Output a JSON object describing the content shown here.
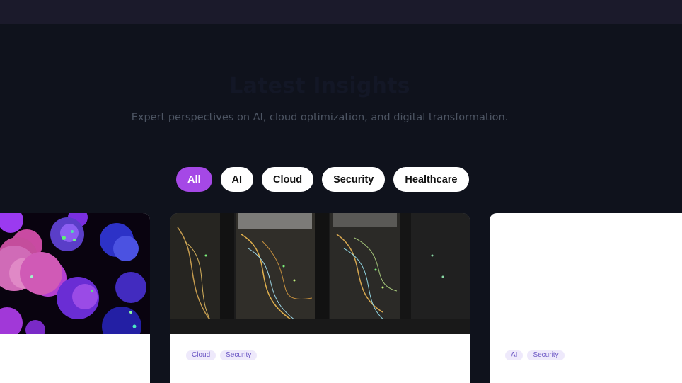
{
  "section": {
    "title": "Latest Insights",
    "subtitle": "Expert perspectives on AI, cloud optimization, and digital transformation."
  },
  "filters": [
    {
      "label": "All",
      "active": true
    },
    {
      "label": "AI",
      "active": false
    },
    {
      "label": "Cloud",
      "active": false
    },
    {
      "label": "Security",
      "active": false
    },
    {
      "label": "Healthcare",
      "active": false
    }
  ],
  "cards": [
    {
      "image": "cell-microscopy-image",
      "tags": []
    },
    {
      "image": "server-rack-image",
      "tags": [
        "Cloud",
        "Security"
      ]
    },
    {
      "image": "blank-image",
      "tags": [
        "AI",
        "Security"
      ]
    }
  ],
  "colors": {
    "accent": "#a548e6",
    "page_background": "#0f121c",
    "topbar_background": "#1b1a2b"
  }
}
